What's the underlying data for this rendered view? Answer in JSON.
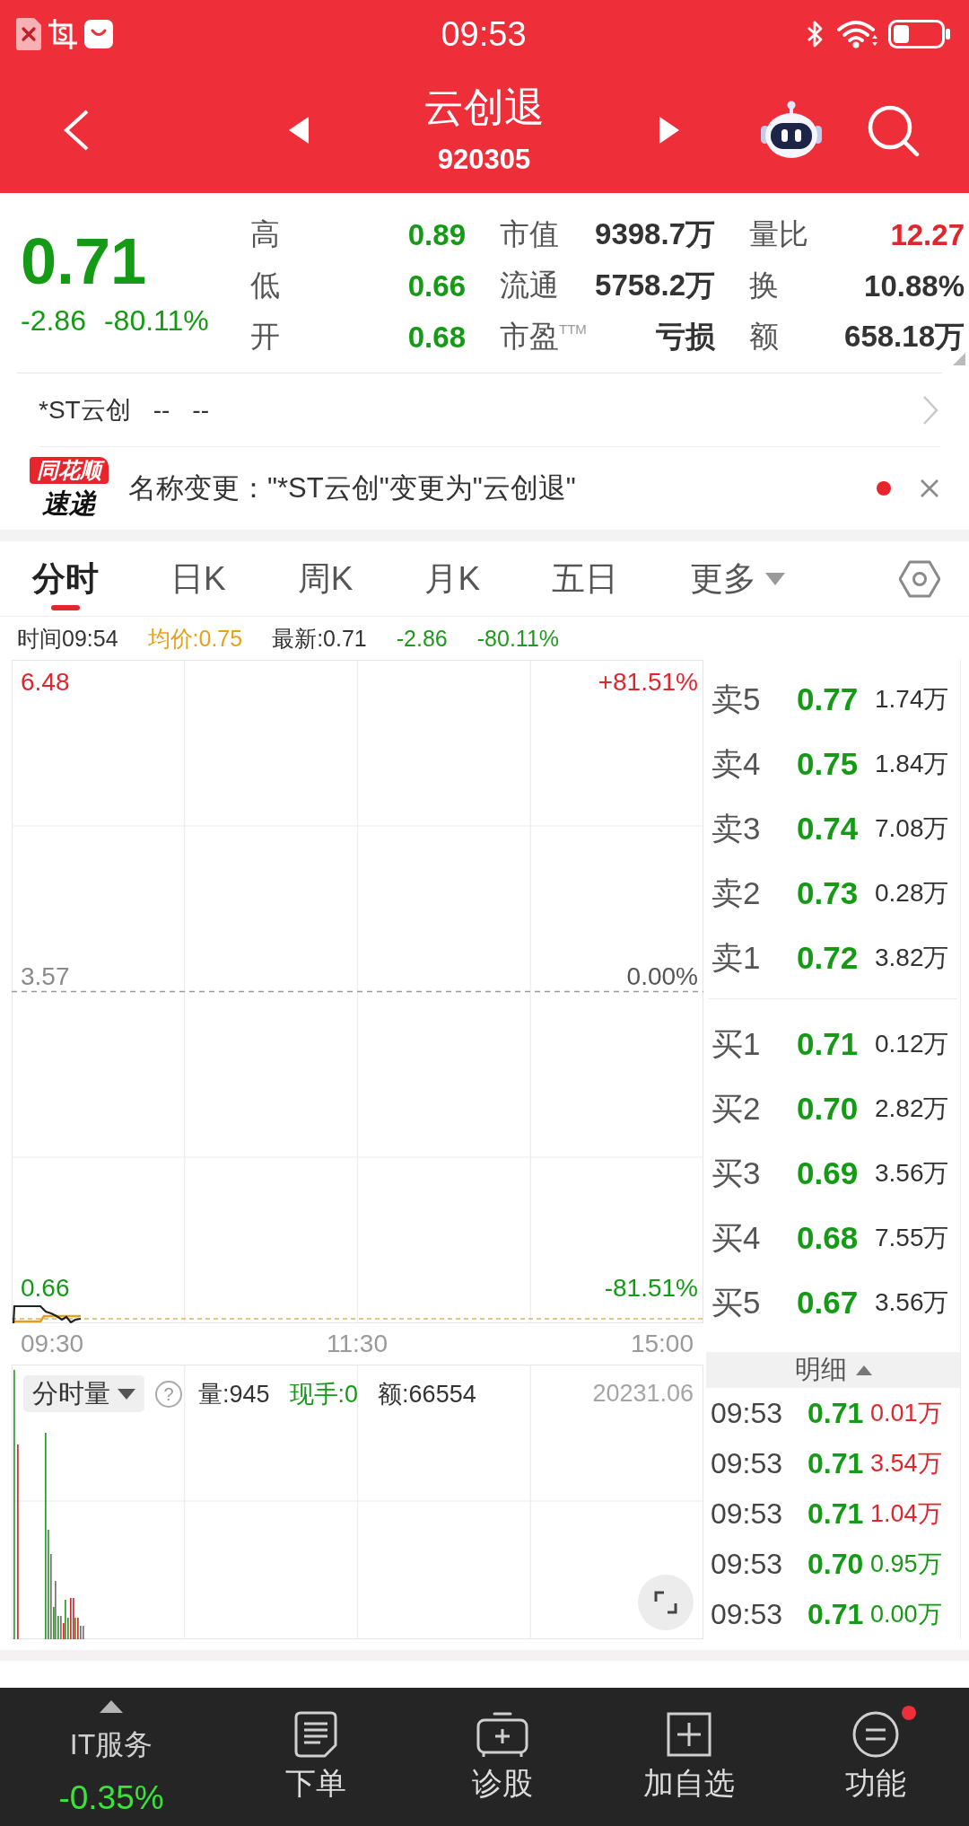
{
  "status_bar": {
    "time": "09:53"
  },
  "header": {
    "title": "云创退",
    "code": "920305"
  },
  "quote": {
    "price": "0.71",
    "falling": true,
    "change": "-2.86",
    "change_pct": "-80.11%",
    "stats": [
      {
        "label": "高",
        "value": "0.89",
        "color": "#159a15"
      },
      {
        "label": "市值",
        "value": "9398.7万",
        "color": "#333333"
      },
      {
        "label": "量比",
        "value": "12.27",
        "color": "#e0262d"
      },
      {
        "label": "低",
        "value": "0.66",
        "color": "#159a15"
      },
      {
        "label": "流通",
        "value": "5758.2万",
        "color": "#333333"
      },
      {
        "label": "换",
        "value": "10.88%",
        "color": "#333333"
      },
      {
        "label": "开",
        "value": "0.68",
        "color": "#159a15"
      },
      {
        "label": "市盈$^{TTM}$",
        "value": "亏损",
        "color": "#333333"
      },
      {
        "label": "额",
        "value": "658.18万",
        "color": "#333333"
      }
    ]
  },
  "former_name": {
    "name": "*ST云创",
    "values": [
      "--",
      "--"
    ]
  },
  "news": {
    "source": "同花顺",
    "source_sub": "速递",
    "text": "名称变更：\"*ST云创\"变更为\"云创退\"",
    "unread": true
  },
  "tabs": [
    {
      "label": "分时",
      "kind": "tab",
      "selected": true
    },
    {
      "label": "日K",
      "kind": "tab",
      "selected": false
    },
    {
      "label": "周K",
      "kind": "tab",
      "selected": false
    },
    {
      "label": "月K",
      "kind": "tab",
      "selected": false
    },
    {
      "label": "五日",
      "kind": "tab",
      "selected": false
    },
    {
      "label": "更多",
      "kind": "menu",
      "selected": false
    }
  ],
  "info": [
    {
      "text": "时间09:54",
      "color": "#333333"
    },
    {
      "text": "均价:0.75",
      "color": "#e6a11b"
    },
    {
      "text": "最新:0.71",
      "color": "#333333"
    },
    {
      "text": "-2.86",
      "color": "#1f9a1f"
    },
    {
      "text": "-80.11%",
      "color": "#1f9a1f"
    }
  ],
  "price_chart": {
    "left_labels": [
      {
        "text": "6.48",
        "color": "#e0262d"
      },
      {
        "text": "3.57",
        "color": "#8a8a8a"
      },
      {
        "text": "0.66",
        "color": "#159a15"
      }
    ],
    "right_labels": [
      {
        "text": "+81.51%",
        "color": "#e0262d"
      },
      {
        "text": "0.00%",
        "color": "#555555"
      },
      {
        "text": "-81.51%",
        "color": "#159a15"
      }
    ],
    "times": [
      "09:30",
      "11:30",
      "15:00"
    ]
  },
  "volume_chart": {
    "selector": "分时量",
    "help": "?",
    "stats": [
      {
        "text": "量:945",
        "color": "#333333"
      },
      {
        "text": "现手:0",
        "color": "#159a15"
      },
      {
        "text": "额:66554",
        "color": "#333333"
      }
    ],
    "date": "20231.06"
  },
  "order_book": {
    "asks": [
      {
        "label": "卖5",
        "price": "0.77",
        "color": "#159a15",
        "volume": "1.74万"
      },
      {
        "label": "卖4",
        "price": "0.75",
        "color": "#159a15",
        "volume": "1.84万"
      },
      {
        "label": "卖3",
        "price": "0.74",
        "color": "#159a15",
        "volume": "7.08万"
      },
      {
        "label": "卖2",
        "price": "0.73",
        "color": "#159a15",
        "volume": "0.28万"
      },
      {
        "label": "卖1",
        "price": "0.72",
        "color": "#159a15",
        "volume": "3.82万"
      }
    ],
    "bids": [
      {
        "label": "买1",
        "price": "0.71",
        "color": "#159a15",
        "volume": "0.12万"
      },
      {
        "label": "买2",
        "price": "0.70",
        "color": "#159a15",
        "volume": "2.82万"
      },
      {
        "label": "买3",
        "price": "0.69",
        "color": "#159a15",
        "volume": "3.56万"
      },
      {
        "label": "买4",
        "price": "0.68",
        "color": "#159a15",
        "volume": "7.55万"
      },
      {
        "label": "买5",
        "price": "0.67",
        "color": "#159a15",
        "volume": "3.56万"
      }
    ]
  },
  "trades": {
    "header": "明细",
    "rows": [
      {
        "time": "09:53",
        "price": {
          "text": "0.71",
          "color": "#159a15"
        },
        "volume": {
          "text": "0.01万",
          "color": "#e0262d"
        }
      },
      {
        "time": "09:53",
        "price": {
          "text": "0.71",
          "color": "#159a15"
        },
        "volume": {
          "text": "3.54万",
          "color": "#e0262d"
        }
      },
      {
        "time": "09:53",
        "price": {
          "text": "0.71",
          "color": "#159a15"
        },
        "volume": {
          "text": "1.04万",
          "color": "#e0262d"
        }
      },
      {
        "time": "09:53",
        "price": {
          "text": "0.70",
          "color": "#159a15"
        },
        "volume": {
          "text": "0.95万",
          "color": "#159a15"
        }
      },
      {
        "time": "09:53",
        "price": {
          "text": "0.71",
          "color": "#159a15"
        },
        "volume": {
          "text": "0.00万",
          "color": "#159a15"
        }
      }
    ]
  },
  "bottom_bar": {
    "sector": {
      "name": "IT服务",
      "change": "-0.35%",
      "falling": true
    },
    "actions": [
      {
        "label": "下单",
        "kind": "order",
        "badge": false
      },
      {
        "label": "诊股",
        "kind": "diagnose",
        "badge": false
      },
      {
        "label": "加自选",
        "kind": "watchlist",
        "badge": false
      },
      {
        "label": "功能",
        "kind": "menu",
        "badge": true
      }
    ]
  }
}
